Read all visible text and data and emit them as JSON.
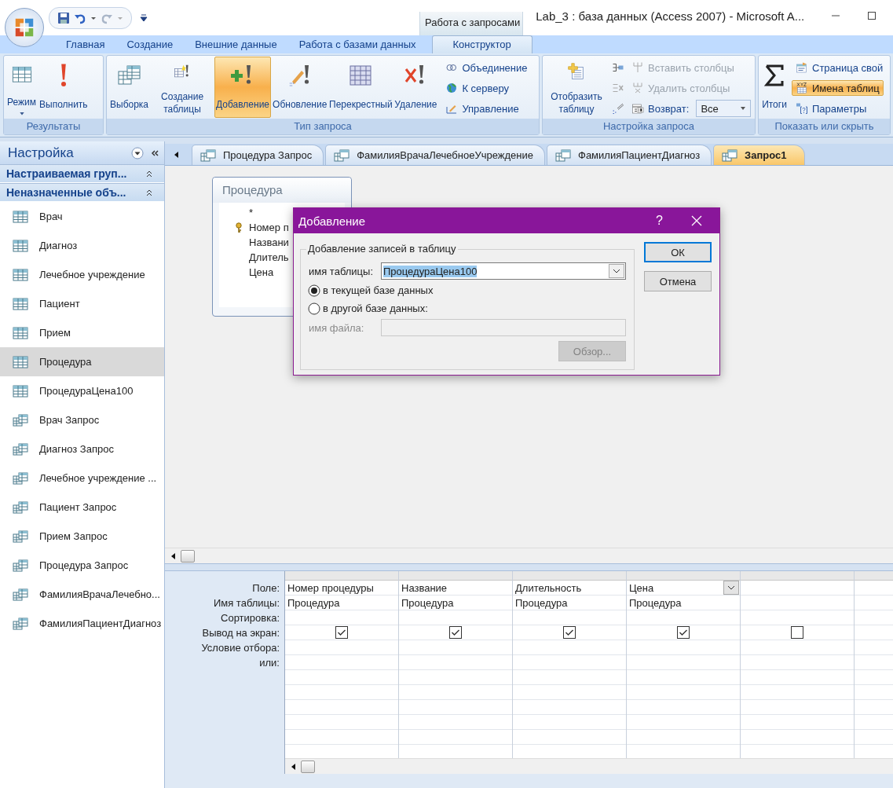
{
  "window": {
    "title": "Lab_3 : база данных (Access 2007) - Microsoft A...",
    "contextual_group": "Работа с запросами"
  },
  "ribbon_tabs": [
    {
      "label": "Главная",
      "selected": false
    },
    {
      "label": "Создание",
      "selected": false
    },
    {
      "label": "Внешние данные",
      "selected": false
    },
    {
      "label": "Работа с базами данных",
      "selected": false
    },
    {
      "label": "Конструктор",
      "selected": true
    }
  ],
  "ribbon_groups": [
    {
      "label": "Результаты",
      "large_buttons": [
        {
          "label": "Режим",
          "dropdown": true,
          "selected": false
        },
        {
          "label": "Выполнить",
          "dropdown": false,
          "selected": false
        }
      ]
    },
    {
      "label": "Тип запроса",
      "large_buttons": [
        {
          "label": "Выборка",
          "dropdown": false,
          "selected": false
        },
        {
          "label": "Создание таблицы",
          "dropdown": false,
          "selected": false
        },
        {
          "label": "Добавление",
          "dropdown": false,
          "selected": true
        },
        {
          "label": "Обновление",
          "dropdown": false,
          "selected": false
        },
        {
          "label": "Перекрестный",
          "dropdown": false,
          "selected": false
        },
        {
          "label": "Удаление",
          "dropdown": false,
          "selected": false
        }
      ],
      "small_buttons": [
        {
          "label": "Объединение",
          "disabled": false,
          "selected": false
        },
        {
          "label": "К серверу",
          "disabled": false,
          "selected": false
        },
        {
          "label": "Управление",
          "disabled": false,
          "selected": false
        }
      ]
    },
    {
      "label": "Настройка запроса",
      "large_buttons": [
        {
          "label": "Отобразить таблицу",
          "dropdown": false,
          "selected": false
        }
      ],
      "small_buttons": [
        {
          "label": "Вставить столбцы",
          "disabled": true,
          "selected": false
        },
        {
          "label": "Удалить столбцы",
          "disabled": true,
          "selected": false
        },
        {
          "label": "Возврат:",
          "disabled": false,
          "selected": false,
          "combo_value": "Все"
        }
      ]
    },
    {
      "label": "Показать или скрыть",
      "large_buttons": [
        {
          "label": "Итоги",
          "dropdown": false,
          "selected": false
        }
      ],
      "small_buttons": [
        {
          "label": "Страница свой",
          "disabled": false,
          "selected": false
        },
        {
          "label": "Имена таблиц",
          "disabled": false,
          "selected": true
        },
        {
          "label": "Параметры",
          "disabled": false,
          "selected": false
        }
      ]
    }
  ],
  "navigation": {
    "title": "Настройка",
    "groups": [
      {
        "title": "Настраиваемая груп..."
      },
      {
        "title": "Неназначенные объ..."
      }
    ],
    "items": [
      {
        "label": "Врач",
        "kind": "table",
        "selected": false
      },
      {
        "label": "Диагноз",
        "kind": "table",
        "selected": false
      },
      {
        "label": "Лечебное учреждение",
        "kind": "table",
        "selected": false
      },
      {
        "label": "Пациент",
        "kind": "table",
        "selected": false
      },
      {
        "label": "Прием",
        "kind": "table",
        "selected": false
      },
      {
        "label": "Процедура",
        "kind": "table",
        "selected": true
      },
      {
        "label": "ПроцедураЦена100",
        "kind": "table",
        "selected": false
      },
      {
        "label": "Врач Запрос",
        "kind": "query",
        "selected": false
      },
      {
        "label": "Диагноз Запрос",
        "kind": "query",
        "selected": false
      },
      {
        "label": "Лечебное учреждение ...",
        "kind": "query",
        "selected": false
      },
      {
        "label": "Пациент Запрос",
        "kind": "query",
        "selected": false
      },
      {
        "label": "Прием Запрос",
        "kind": "query",
        "selected": false
      },
      {
        "label": "Процедура Запрос",
        "kind": "query",
        "selected": false
      },
      {
        "label": "ФамилияВрачаЛечебно...",
        "kind": "query",
        "selected": false
      },
      {
        "label": "ФамилияПациентДиагноз",
        "kind": "query",
        "selected": false
      }
    ]
  },
  "document_tabs": [
    {
      "label": "Процедура Запрос",
      "selected": false
    },
    {
      "label": "ФамилияВрачаЛечебноеУчреждение",
      "selected": false
    },
    {
      "label": "ФамилияПациентДиагноз",
      "selected": false
    },
    {
      "label": "Запрос1",
      "selected": true
    }
  ],
  "field_list": {
    "title": "Процедура",
    "fields": [
      {
        "name": "*",
        "key": false
      },
      {
        "name": "Номер п",
        "key": true
      },
      {
        "name": "Названи",
        "key": false
      },
      {
        "name": "Длитель",
        "key": false
      },
      {
        "name": "Цена",
        "key": false
      }
    ]
  },
  "dialog": {
    "title": "Добавление",
    "help": "?",
    "group_title": "Добавление записей в таблицу",
    "table_label": "имя таблицы:",
    "table_value": "ПроцедураЦена100",
    "options": [
      {
        "label": "в текущей базе данных",
        "selected": true
      },
      {
        "label": "в другой базе данных:",
        "selected": false
      }
    ],
    "file_label": "имя файла:",
    "file_disabled": true,
    "browse": "Обзор...",
    "ok": "ОК",
    "cancel": "Отмена"
  },
  "grid": {
    "row_labels": [
      "Поле:",
      "Имя таблицы:",
      "Сортировка:",
      "Вывод на экран:",
      "Условие отбора:",
      "или:"
    ],
    "columns": [
      {
        "field": "Номер процедуры",
        "table": "Процедура",
        "show": true,
        "selected": false
      },
      {
        "field": "Название",
        "table": "Процедура",
        "show": true,
        "selected": false
      },
      {
        "field": "Длительность",
        "table": "Процедура",
        "show": true,
        "selected": false
      },
      {
        "field": "Цена",
        "table": "Процедура",
        "show": true,
        "selected": true
      },
      {
        "show": false,
        "selected": false
      }
    ]
  }
}
